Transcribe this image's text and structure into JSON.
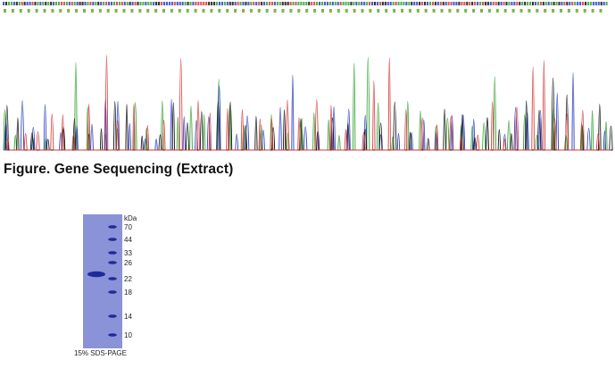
{
  "sequence_figure": {
    "caption": "Figure. Gene Sequencing (Extract)",
    "colors": {
      "A": "#2ea32e",
      "C": "#2a3ec4",
      "G": "#111111",
      "T": "#d23a3a",
      "aa_text": "#7fb44a",
      "nt_text": "#222222"
    }
  },
  "gel_figure": {
    "caption": "15% SDS-PAGE",
    "unit_label": "kDa",
    "markers": [
      "70",
      "44",
      "33",
      "26",
      "22",
      "18",
      "14",
      "10"
    ],
    "colors": {
      "lane_background": "#8a92d8",
      "band": "#1e2a9a"
    }
  }
}
